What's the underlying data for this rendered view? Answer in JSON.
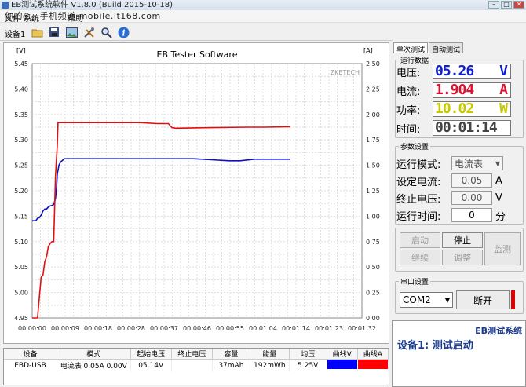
{
  "window": {
    "title": "EB测试系统软件 V1.8.0 (Build 2015-10-18)"
  },
  "watermark": "你的◎・手机频道 mobile.it168.com",
  "menu": {
    "file": "文件",
    "device": "系统",
    "help": "帮助"
  },
  "toolbar": {
    "device_label": "设备1"
  },
  "chart_data": {
    "type": "line",
    "title": "EB Tester Software",
    "watermark": "ZKETECH",
    "ylabel": "[V]",
    "y2label": "[A]",
    "ylim": [
      4.95,
      5.45
    ],
    "y2lim": [
      0,
      2.5
    ],
    "yticks": [
      "5.45",
      "5.40",
      "5.35",
      "5.30",
      "5.25",
      "5.20",
      "5.15",
      "5.10",
      "5.05",
      "5.00",
      "4.95"
    ],
    "y2ticks": [
      "2.50",
      "2.25",
      "2.00",
      "1.75",
      "1.50",
      "1.25",
      "1.00",
      "0.75",
      "0.50",
      "0.25",
      "0.00"
    ],
    "xticks": [
      "00:00:00",
      "00:00:09",
      "00:00:18",
      "00:00:28",
      "00:00:37",
      "00:00:46",
      "00:00:55",
      "00:01:04",
      "00:01:14",
      "00:01:23",
      "00:01:32"
    ],
    "xlim": [
      0,
      92
    ],
    "grid": true,
    "series": [
      {
        "name": "曲线V",
        "axis": "left",
        "color": "#1010c0",
        "x": [
          0,
          0.5,
          1,
          1.5,
          2,
          2.5,
          3,
          3.5,
          4,
          4.5,
          5,
          5.5,
          6,
          6.2,
          6.5,
          6.8,
          7,
          7.5,
          8,
          9,
          12,
          20,
          30,
          40,
          45,
          50,
          55,
          58,
          62,
          66,
          70,
          72
        ],
        "y": [
          5.141,
          5.141,
          5.141,
          5.146,
          5.147,
          5.152,
          5.16,
          5.164,
          5.164,
          5.168,
          5.17,
          5.171,
          5.173,
          5.178,
          5.185,
          5.205,
          5.233,
          5.251,
          5.257,
          5.263,
          5.263,
          5.263,
          5.263,
          5.263,
          5.263,
          5.261,
          5.259,
          5.259,
          5.262,
          5.262,
          5.262,
          5.262
        ]
      },
      {
        "name": "曲线A",
        "axis": "right",
        "color": "#e01010",
        "x": [
          0,
          1.5,
          2,
          2.5,
          3,
          3.5,
          4,
          4.5,
          5,
          5.5,
          6,
          6.5,
          7,
          7.2,
          8,
          12,
          20,
          30,
          35,
          38,
          39,
          40,
          50,
          60,
          65,
          72
        ],
        "y": [
          0.0,
          0.0,
          0.2,
          0.4,
          0.42,
          0.55,
          0.6,
          0.7,
          0.73,
          0.75,
          0.75,
          1.4,
          1.7,
          1.92,
          1.92,
          1.92,
          1.92,
          1.92,
          1.91,
          1.91,
          1.87,
          1.865,
          1.87,
          1.875,
          1.875,
          1.88
        ]
      }
    ]
  },
  "table": {
    "headers": [
      "设备",
      "模式",
      "起始电压",
      "终止电压",
      "容量",
      "能量",
      "均压",
      "曲线V",
      "曲线A"
    ],
    "row": [
      "EBD-USB",
      "电流表 0.05A  0.00V",
      "05.14V",
      "",
      "37mAh",
      "192mWh",
      "5.25V"
    ],
    "colors": {
      "v": "#0000ff",
      "a": "#ff0000"
    }
  },
  "tabs": [
    "单次测试",
    "自动测试"
  ],
  "run_data": {
    "legend": "运行数据",
    "voltage": {
      "label": "电压:",
      "value": "05.26",
      "unit": "V",
      "color": "#1020d0"
    },
    "current": {
      "label": "电流:",
      "value": "1.904",
      "unit": "A",
      "color": "#e01030"
    },
    "power": {
      "label": "功率:",
      "value": "10.02",
      "unit": "W",
      "color": "#c8c800"
    },
    "time": {
      "label": "时间:",
      "value": "00:01:14",
      "color": "#444444"
    }
  },
  "params": {
    "legend": "参数设置",
    "mode": {
      "label": "运行模式:",
      "value": "电流表"
    },
    "set_current": {
      "label": "设定电流:",
      "value": "0.05",
      "unit": "A"
    },
    "end_voltage": {
      "label": "终止电压:",
      "value": "0.00",
      "unit": "V"
    },
    "run_time": {
      "label": "运行时间:",
      "value": "0",
      "unit": "分"
    }
  },
  "buttons": {
    "start": "启动",
    "stop": "停止",
    "continue": "继续",
    "adjust": "调整",
    "monitor": "监测"
  },
  "serial": {
    "legend": "串口设置",
    "port": "COM2",
    "disconnect": "断开"
  },
  "status": {
    "brand": "EB测试系统",
    "text": "设备1: 测试启动"
  }
}
